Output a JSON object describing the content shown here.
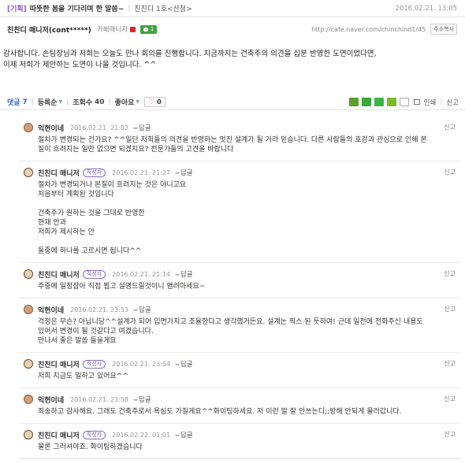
{
  "article": {
    "category": "[기획]",
    "title": "따뜻한 봄을 기다리며 한 말씀~",
    "board": "친친디 1호<산청>",
    "date": "2016.02.21. 13:05"
  },
  "author": {
    "name": "친친디 매니저(cont*****)",
    "level": "카페매니저",
    "talk_count": "1",
    "url": "http://cafe.naver.com/chinchind1/45",
    "copy_label": "주소복사"
  },
  "post": {
    "line1": "감사합니다. 손팀장님과 저희는 오늘도 만나 회의를 진행합니다. 지금까지는 건축주의 의견을 십분 반영한 도면이었다면,",
    "line2": "이제 저희가 제안하는 도면이 나올 것입니다. ^^"
  },
  "comment_bar": {
    "comment_label": "댓글",
    "comment_count": "7",
    "sort_label": "등록순",
    "views_label": "조회수",
    "views_count": "40",
    "like_label": "좋아요",
    "like_count": "0",
    "print_label": "인쇄",
    "report_label": "신고",
    "share_icons": [
      "blog-icon",
      "cafe-icon",
      "me-icon",
      "kakao-icon",
      "bookmark-icon"
    ]
  },
  "comments": [
    {
      "author": "익현이네",
      "is_writer": false,
      "date": "2016.02.21. 21:02",
      "reply": "답글",
      "report": "신고",
      "body": "절차가 변경되는 건가요? ^^일단 저희들의 의견을 반영하는 멋진 설계가 될 거라 믿습니다. 다른 사람들의 호감과 관심으로 인해 본\n질이 흐려지는 일만 없으면 되겠지요? 전문가들의 고견을 바랍니다"
    },
    {
      "author": "친친디 매니저",
      "is_writer": true,
      "writer_label": "작성자",
      "date": "2016.02.21. 21:27",
      "reply": "답글",
      "report": "신고",
      "body": "절차가 변경되거나 본질이 흐려지는 것은 아니고요\n처음부터 계획된 것입니다\n\n건축주가 원하는 것을 그대로 반영한\n현재 안과\n저희가 제시하는 안\n\n둘중에 하나를 고르시면 됩니다^^"
    },
    {
      "author": "친친디 매니저",
      "is_writer": true,
      "writer_label": "작성자",
      "date": "2016.02.21. 21:14",
      "reply": "답글",
      "report": "신고",
      "body": "주중에 일정잡아 직접 뵙고 설명드릴것이니 염려마세요~"
    },
    {
      "author": "익현이네",
      "is_writer": false,
      "date": "2016.02.21. 23:53",
      "reply": "답글",
      "report": "신고",
      "body": "걱정은 무슨? 아닙니당^^설계가 되어 입면가지고 조율한다고 생각했거든요. 설계는 픽스 된 듯하여! 근데 일전에 전화주신 내용도\n있어서 변경이 될 것같다고 여겼습니다.\n만나서 좋은 말씀 들을게요"
    },
    {
      "author": "친친디 매니저",
      "is_writer": true,
      "writer_label": "작성자",
      "date": "2016.02.21. 23:54",
      "reply": "답글",
      "report": "신고",
      "body": "저희 지금도 일하고 있어요^^"
    },
    {
      "author": "익현이네",
      "is_writer": false,
      "date": "2016.02.21. 23:58",
      "reply": "답글",
      "report": "신고",
      "body": "죄송하고 감사해요. 그래도 건축주로서 욕심도 가질게요^^화이팅하세요. 저 이런 말 잘 안쓰는디;;방해 안되게 물러갑니다."
    },
    {
      "author": "친친디 매니저",
      "is_writer": true,
      "writer_label": "작성자",
      "date": "2016.02.22. 01:01",
      "reply": "답글",
      "report": "신고",
      "body": "물론 그러셔야죠. 화이팅하겠습니다"
    }
  ]
}
